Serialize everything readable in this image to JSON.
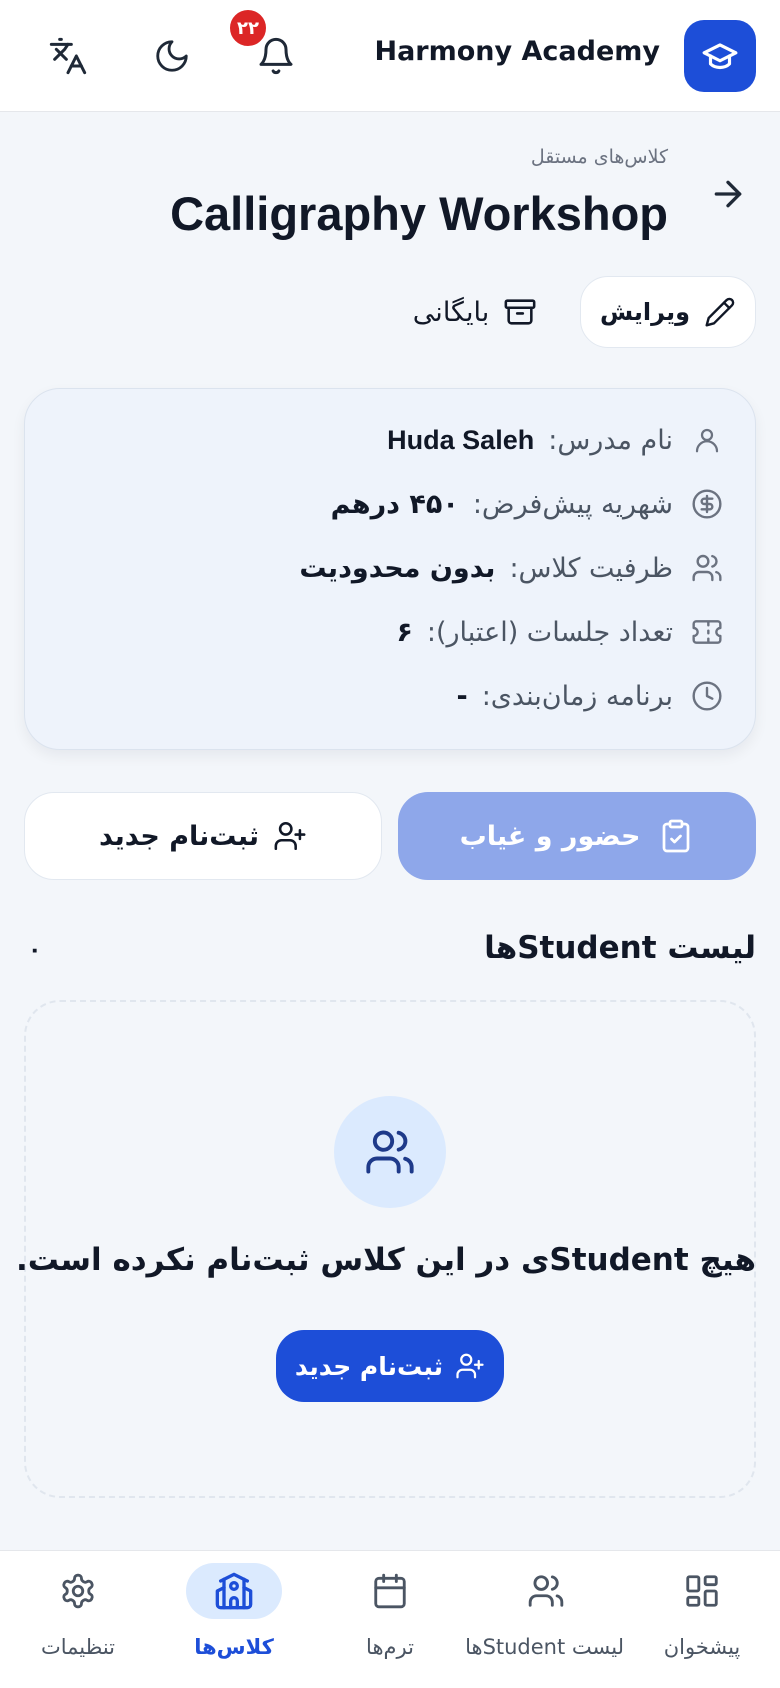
{
  "app": {
    "title": "Harmony Academy",
    "notification_count": "۲۲"
  },
  "header": {
    "breadcrumb": "کلاس‌های مستقل",
    "title": "Calligraphy Workshop",
    "edit_label": "ویرایش",
    "archive_label": "بایگانی"
  },
  "info": {
    "teacher": {
      "label": "نام مدرس:",
      "value": "Huda Saleh"
    },
    "fee": {
      "label": "شهریه پیش‌فرض:",
      "value": "۴۵۰ درهم"
    },
    "capacity": {
      "label": "ظرفیت کلاس:",
      "value": "بدون محدودیت"
    },
    "sessions": {
      "label": "تعداد جلسات (اعتبار):",
      "value": "۶"
    },
    "schedule": {
      "label": "برنامه زمان‌بندی:",
      "value": "-"
    }
  },
  "actions": {
    "attendance_label": "حضور و غیاب",
    "new_enrollment_label": "ثبت‌نام جدید"
  },
  "students": {
    "title": "لیست Studentها",
    "count": "۰",
    "empty_message": "هیچ Studentی در این کلاس ثبت‌نام نکرده است.",
    "empty_cta": "ثبت‌نام جدید"
  },
  "nav": {
    "items": [
      {
        "label": "پیشخوان",
        "icon": "dashboard-icon"
      },
      {
        "label": "لیست Studentها",
        "icon": "users-icon"
      },
      {
        "label": "ترم‌ها",
        "icon": "calendar-icon"
      },
      {
        "label": "کلاس‌ها",
        "icon": "school-icon",
        "active": true
      },
      {
        "label": "تنظیمات",
        "icon": "gear-icon"
      }
    ]
  },
  "colors": {
    "primary": "#1d4ed8",
    "primary_muted": "#8ea7ea",
    "badge": "#dc2626",
    "card_bg": "#eef3fb"
  }
}
